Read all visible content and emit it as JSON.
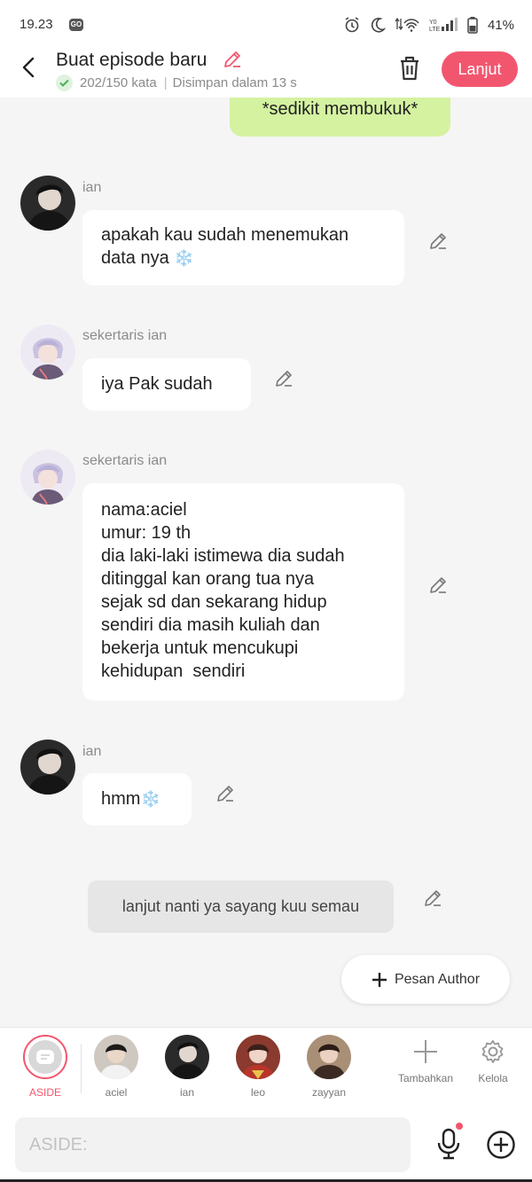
{
  "status_bar": {
    "time": "19.23",
    "badge": "GO",
    "battery": "41%"
  },
  "header": {
    "title": "Buat episode baru",
    "word_count": "202/150 kata",
    "separator": "|",
    "saved": "Disimpan dalam 13 s",
    "next_label": "Lanjut"
  },
  "messages": [
    {
      "type": "self",
      "text": "*sedikit membukuk*"
    },
    {
      "type": "char",
      "name": "ian",
      "text": "apakah kau sudah menemukan data nya",
      "emoji": "❄️"
    },
    {
      "type": "char",
      "name": "sekertaris ian",
      "text": "iya Pak sudah"
    },
    {
      "type": "char",
      "name": "sekertaris ian",
      "lines": [
        "nama:aciel",
        "umur: 19 th",
        "dia laki-laki istimewa dia sudah",
        "ditinggal kan orang tua nya",
        "sejak sd dan sekarang hidup",
        "sendiri dia masih kuliah dan",
        "bekerja untuk mencukupi",
        "kehidupan  sendiri"
      ]
    },
    {
      "type": "char",
      "name": "ian",
      "text": "hmm",
      "emoji": "❄️"
    },
    {
      "type": "aside",
      "text": "lanjut nanti ya sayang kuu semau"
    }
  ],
  "pesan_author": "Pesan Author",
  "characters": [
    {
      "label": "ASIDE",
      "color": "#f2566e"
    },
    {
      "label": "aciel"
    },
    {
      "label": "ian"
    },
    {
      "label": "leo"
    },
    {
      "label": "zayyan"
    }
  ],
  "tools": {
    "add_label": "Tambahkan",
    "manage_label": "Kelola"
  },
  "input": {
    "placeholder": "ASIDE:"
  },
  "colors": {
    "accent": "#f2566e",
    "self_bubble": "#d4f2a0",
    "background": "#f5f5f5"
  },
  "icons": [
    "back-arrow-icon",
    "pencil-icon",
    "check-icon",
    "trash-icon",
    "plus-icon",
    "gear-icon",
    "microphone-icon",
    "plus-circle-icon",
    "chat-bubble-icon"
  ]
}
